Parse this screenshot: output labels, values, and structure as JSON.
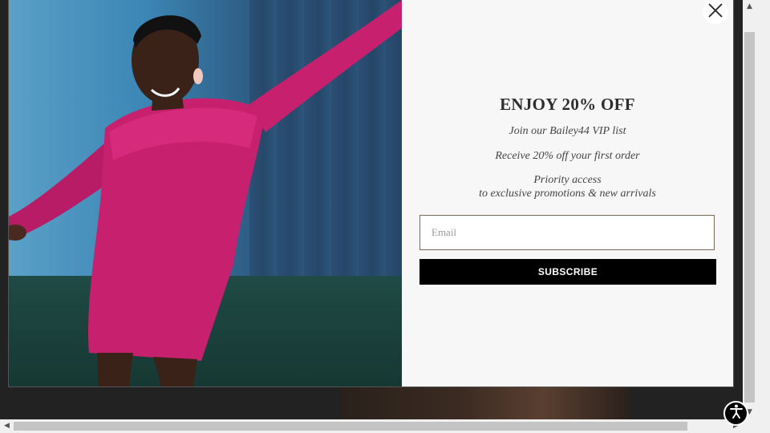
{
  "popup": {
    "headline": "ENJOY 20% OFF",
    "line1": "Join our Bailey44 VIP list",
    "line2": "Receive 20% off your first order",
    "line3": "Priority access",
    "line4": "to exclusive promotions & new arrivals",
    "email_placeholder": "Email",
    "email_value": "",
    "subscribe_label": "SUBSCRIBE"
  },
  "icons": {
    "close": "close-icon",
    "accessibility": "accessibility-icon",
    "scroll_up": "▲",
    "scroll_down": "▼",
    "scroll_left": "◀",
    "scroll_right": "▶"
  },
  "colors": {
    "subscribe_bg": "#000000",
    "dress": "#c7206f",
    "panel_bg": "#f7f7f7"
  }
}
